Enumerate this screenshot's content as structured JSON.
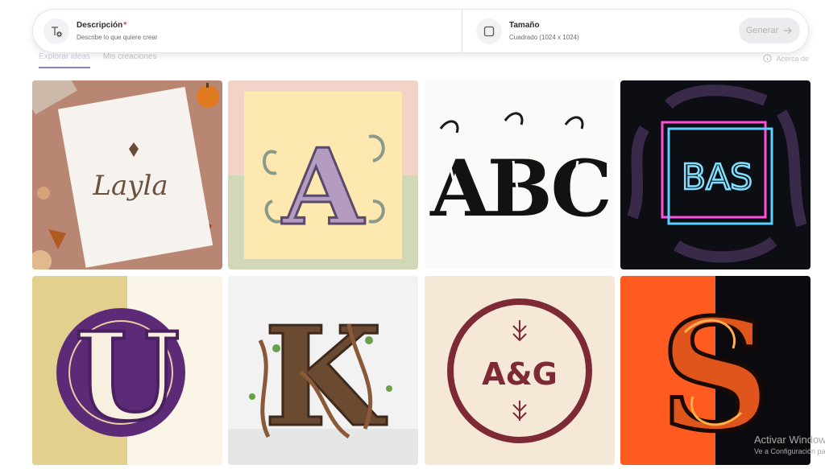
{
  "prompt_bar": {
    "description": {
      "label": "Descripción",
      "required_mark": "*",
      "hint": "Describe lo que quiere crear",
      "icon": "text-add-icon"
    },
    "size": {
      "label": "Tamaño",
      "value": "Cuadrado (1024 x 1024)",
      "icon": "square-icon"
    },
    "generate_label": "Generar"
  },
  "tabs": [
    {
      "label": "Explorar ideas",
      "active": true
    },
    {
      "label": "Mis creaciones",
      "active": false
    }
  ],
  "about_label": "Acerca de",
  "gallery": {
    "cards": [
      {
        "name": "card-layla",
        "text": "Layla"
      },
      {
        "name": "card-letter-a",
        "text": "A"
      },
      {
        "name": "card-abc",
        "text": "ABC"
      },
      {
        "name": "card-bas-neon",
        "text": "BAS"
      },
      {
        "name": "card-letter-u",
        "text": "U"
      },
      {
        "name": "card-letter-k",
        "text": "K"
      },
      {
        "name": "card-ag-monogram",
        "text": "A&G"
      },
      {
        "name": "card-letter-s",
        "text": "S"
      }
    ]
  },
  "watermark": {
    "line1": "Activar Windows",
    "line2": "Ve a Configuración para activar Windows."
  },
  "colors": {
    "accent": "#8b85c8",
    "required": "#c9375a",
    "neon_pink": "#ff4fd8",
    "neon_blue": "#59d0ff",
    "monogram": "#7d2a36",
    "flame": "#ff5a1f"
  }
}
